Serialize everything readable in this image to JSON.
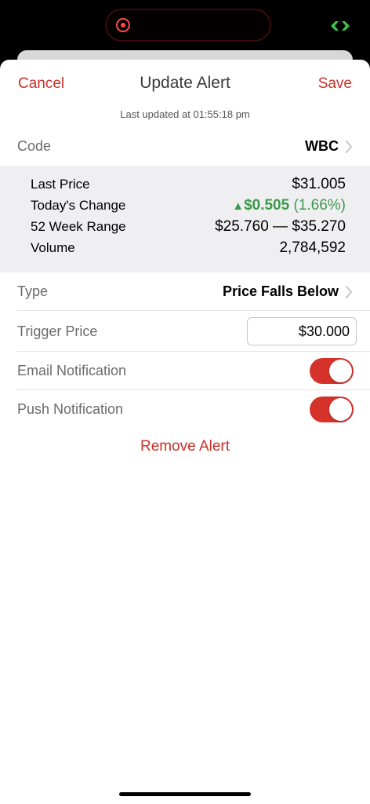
{
  "nav": {
    "cancel_label": "Cancel",
    "title": "Update Alert",
    "save_label": "Save"
  },
  "last_updated": "Last updated at 01:55:18 pm",
  "code": {
    "label": "Code",
    "value": "WBC"
  },
  "stats": {
    "last_price_label": "Last Price",
    "last_price_value": "$31.005",
    "change_label": "Today's Change",
    "change_arrow": "▲",
    "change_amount": "$0.505",
    "change_percent": "(1.66%)",
    "range_label": "52 Week Range",
    "range_value": "$25.760 — $35.270",
    "volume_label": "Volume",
    "volume_value": "2,784,592"
  },
  "type": {
    "label": "Type",
    "value": "Price Falls Below"
  },
  "trigger": {
    "label": "Trigger Price",
    "value": "$30.000"
  },
  "email_notification": {
    "label": "Email Notification",
    "enabled": true
  },
  "push_notification": {
    "label": "Push Notification",
    "enabled": true
  },
  "remove_label": "Remove Alert",
  "colors": {
    "accent": "#c8312a",
    "toggle_on": "#d5322a",
    "positive": "#3d9a4a",
    "stats_background": "#efeff2"
  },
  "icons": {
    "chevron": "chevron-right-icon",
    "recording": "screen-recording-icon",
    "link": "link-icon"
  }
}
